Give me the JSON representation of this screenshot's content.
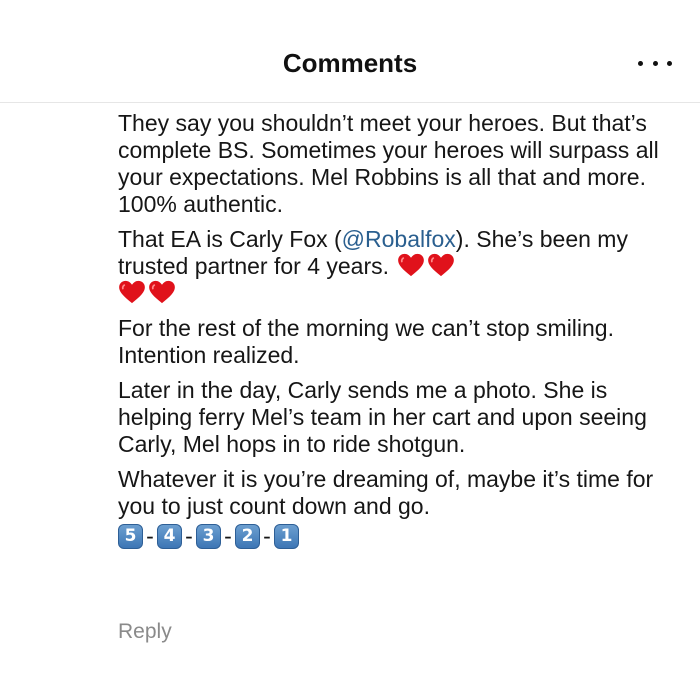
{
  "header": {
    "title": "Comments",
    "more_icon": "ellipsis-horizontal-icon"
  },
  "comment": {
    "para1": "They say you shouldn’t meet your heroes. But that’s complete BS. Sometimes your heroes will surpass all your expectations. Mel Robbins is all that and more. 100% authentic.",
    "para2_before": "That EA is Carly Fox (",
    "mention": "@Robalfox",
    "para2_after": "). She’s been my trusted partner for 4 years.",
    "hearts_icon": "red-heart-icon",
    "para3": "For the rest of the morning we can’t stop smiling. Intention realized.",
    "para4": "Later in the day, Carly sends me a photo. She is helping ferry Mel’s team in her cart and upon seeing Carly, Mel hops in to ride shotgun.",
    "para5": "Whatever it is you’re dreaming of, maybe it’s time for you to just count down and go.",
    "countdown": [
      "5",
      "4",
      "3",
      "2",
      "1"
    ],
    "countdown_separator": "-"
  },
  "actions": {
    "reply_label": "Reply"
  },
  "colors": {
    "mention": "#2a5f8f",
    "heart": "#e0121b",
    "keycap": "#4a83c0",
    "reply": "#8a8a8a"
  }
}
